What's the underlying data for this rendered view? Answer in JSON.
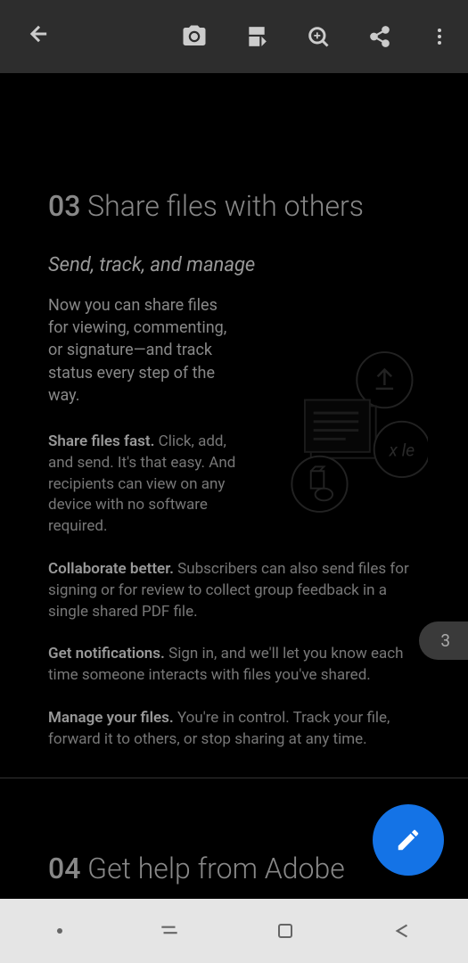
{
  "toolbar": {
    "back": "back",
    "camera": "camera",
    "document": "document",
    "search": "search",
    "share": "share",
    "menu": "menu"
  },
  "section03": {
    "number": "03",
    "title": "Share files with others",
    "subtitle": "Send, track, and manage",
    "intro": "Now you can share files for viewing, commenting, or signature—and track status every step of the way.",
    "feature1_title": "Share files fast.",
    "feature1_text": " Click, add, and send. It's that easy. And recipients can view on any device with no software required.",
    "feature2_title": "Collaborate better.",
    "feature2_text": " Subscribers can also send files for signing or for review to collect group feedback in a single shared PDF file.",
    "feature3_title": "Get notifications.",
    "feature3_text": " Sign in, and we'll let you know each time someone interacts with files you've shared.",
    "feature4_title": "Manage your files.",
    "feature4_text": " You're in control. Track your file, forward it to others, or stop sharing at any time."
  },
  "section04": {
    "number": "04",
    "title": "Get help from Adobe"
  },
  "page_number": "3",
  "colors": {
    "fab": "#1473e6",
    "topbar": "#2d2d2d",
    "navbar": "#e5e5e5"
  }
}
